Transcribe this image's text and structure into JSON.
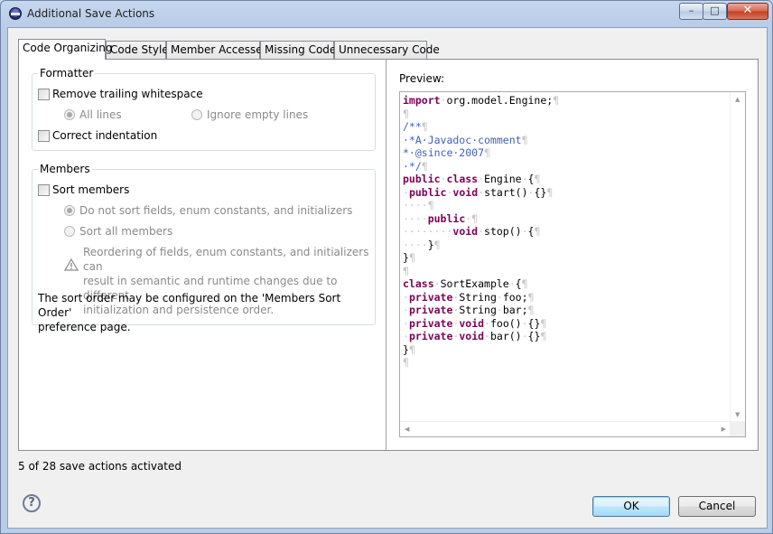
{
  "window": {
    "title": "Additional Save Actions",
    "minimize_glyph": "–",
    "maximize_glyph": "□",
    "close_glyph": "✕"
  },
  "tabs": [
    {
      "label": "Code Organizing",
      "active": true
    },
    {
      "label": "Code Style",
      "active": false
    },
    {
      "label": "Member Accesses",
      "active": false
    },
    {
      "label": "Missing Code",
      "active": false
    },
    {
      "label": "Unnecessary Code",
      "active": false
    }
  ],
  "formatter": {
    "title": "Formatter",
    "remove_trailing_whitespace": {
      "label": "Remove trailing whitespace",
      "checked": false
    },
    "all_lines": {
      "label": "All lines",
      "selected": true,
      "enabled": false
    },
    "ignore_empty_lines": {
      "label": "Ignore empty lines",
      "selected": false,
      "enabled": false
    },
    "correct_indentation": {
      "label": "Correct indentation",
      "checked": false
    }
  },
  "members": {
    "title": "Members",
    "sort_members": {
      "label": "Sort members",
      "checked": false
    },
    "do_not_sort": {
      "label": "Do not sort fields, enum constants, and initializers",
      "selected": true,
      "enabled": false
    },
    "sort_all": {
      "label": "Sort all members",
      "selected": false,
      "enabled": false
    },
    "warning_lines": [
      "Reordering of fields, enum constants, and initializers can",
      "result in semantic and runtime changes due to different",
      "initialization and persistence order."
    ],
    "sort_order_lines": [
      "The sort order may be configured on the 'Members Sort Order'",
      "preference page."
    ]
  },
  "preview": {
    "label": "Preview:",
    "code_lines": [
      [
        [
          "kw",
          "import"
        ],
        [
          "ws",
          "·"
        ],
        [
          "t",
          "org.model.Engine;"
        ],
        [
          "ws",
          "¶"
        ]
      ],
      [
        [
          "ws",
          "¶"
        ]
      ],
      [
        [
          "cm",
          "/**"
        ],
        [
          "ws",
          "¶"
        ]
      ],
      [
        [
          "cm",
          "·*A·Javadoc·comment"
        ],
        [
          "ws",
          "¶"
        ]
      ],
      [
        [
          "cm",
          "*·@since·2007"
        ],
        [
          "ws",
          "¶"
        ]
      ],
      [
        [
          "cm",
          "·*/"
        ],
        [
          "ws",
          "¶"
        ]
      ],
      [
        [
          "kw",
          "public"
        ],
        [
          "ws",
          "·"
        ],
        [
          "kw",
          "class"
        ],
        [
          "ws",
          "·"
        ],
        [
          "t",
          "Engine"
        ],
        [
          "ws",
          "·"
        ],
        [
          "t",
          "{"
        ],
        [
          "ws",
          "¶"
        ]
      ],
      [
        [
          "ws",
          "·"
        ],
        [
          "kw",
          "public"
        ],
        [
          "ws",
          "·"
        ],
        [
          "kw",
          "void"
        ],
        [
          "ws",
          "·"
        ],
        [
          "t",
          "start()"
        ],
        [
          "ws",
          "·"
        ],
        [
          "t",
          "{}"
        ],
        [
          "ws",
          "¶"
        ]
      ],
      [
        [
          "ws",
          "····¶"
        ]
      ],
      [
        [
          "ws",
          "····"
        ],
        [
          "kw",
          "public"
        ],
        [
          "ws",
          "·¶"
        ]
      ],
      [
        [
          "ws",
          "········"
        ],
        [
          "kw",
          "void"
        ],
        [
          "ws",
          "·"
        ],
        [
          "t",
          "stop()"
        ],
        [
          "ws",
          "·"
        ],
        [
          "t",
          "{"
        ],
        [
          "ws",
          "¶"
        ]
      ],
      [
        [
          "ws",
          "····"
        ],
        [
          "t",
          "}"
        ],
        [
          "ws",
          "¶"
        ]
      ],
      [
        [
          "t",
          "}"
        ],
        [
          "ws",
          "¶"
        ]
      ],
      [
        [
          "ws",
          "¶"
        ]
      ],
      [
        [
          "kw",
          "class"
        ],
        [
          "ws",
          "·"
        ],
        [
          "t",
          "SortExample"
        ],
        [
          "ws",
          "·"
        ],
        [
          "t",
          "{"
        ],
        [
          "ws",
          "¶"
        ]
      ],
      [
        [
          "ws",
          "·"
        ],
        [
          "kw",
          "private"
        ],
        [
          "ws",
          "·"
        ],
        [
          "t",
          "String"
        ],
        [
          "ws",
          "·"
        ],
        [
          "t",
          "foo;"
        ],
        [
          "ws",
          "¶"
        ]
      ],
      [
        [
          "ws",
          "·"
        ],
        [
          "kw",
          "private"
        ],
        [
          "ws",
          "·"
        ],
        [
          "t",
          "String"
        ],
        [
          "ws",
          "·"
        ],
        [
          "t",
          "bar;"
        ],
        [
          "ws",
          "¶"
        ]
      ],
      [
        [
          "ws",
          "·"
        ],
        [
          "kw",
          "private"
        ],
        [
          "ws",
          "·"
        ],
        [
          "kw",
          "void"
        ],
        [
          "ws",
          "·"
        ],
        [
          "t",
          "foo()"
        ],
        [
          "ws",
          "·"
        ],
        [
          "t",
          "{}"
        ],
        [
          "ws",
          "¶"
        ]
      ],
      [
        [
          "ws",
          "·"
        ],
        [
          "kw",
          "private"
        ],
        [
          "ws",
          "·"
        ],
        [
          "kw",
          "void"
        ],
        [
          "ws",
          "·"
        ],
        [
          "t",
          "bar()"
        ],
        [
          "ws",
          "·"
        ],
        [
          "t",
          "{}"
        ],
        [
          "ws",
          "¶"
        ]
      ],
      [
        [
          "t",
          "}"
        ],
        [
          "ws",
          "¶"
        ]
      ],
      [
        [
          "ws",
          "¶"
        ]
      ]
    ]
  },
  "status_text": "5 of 28 save actions activated",
  "buttons": {
    "ok": "OK",
    "cancel": "Cancel",
    "help_glyph": "?"
  },
  "colors": {
    "keyword": "#7f0055",
    "javadoc": "#3f5fbf",
    "whitespace_marker": "#c7c7c7"
  }
}
